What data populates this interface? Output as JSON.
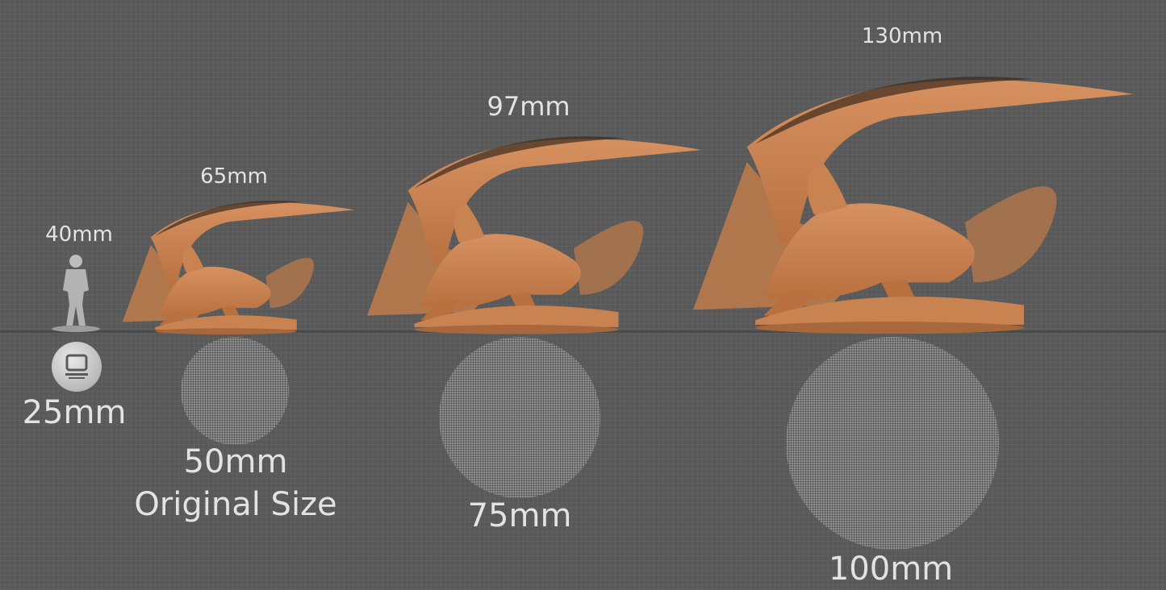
{
  "height_labels": [
    "40mm",
    "65mm",
    "97mm",
    "130mm"
  ],
  "base_labels": [
    "25mm",
    "50mm",
    "75mm",
    "100mm"
  ],
  "original_size_label": "Original Size",
  "icons": [
    "human-scale-figure-icon",
    "dragon-figure-icon",
    "logo-coin-icon"
  ],
  "colors": {
    "background": "#595959",
    "dragon": "#c98350",
    "disc": "#8e8e8e",
    "text": "#e3e3e3"
  }
}
